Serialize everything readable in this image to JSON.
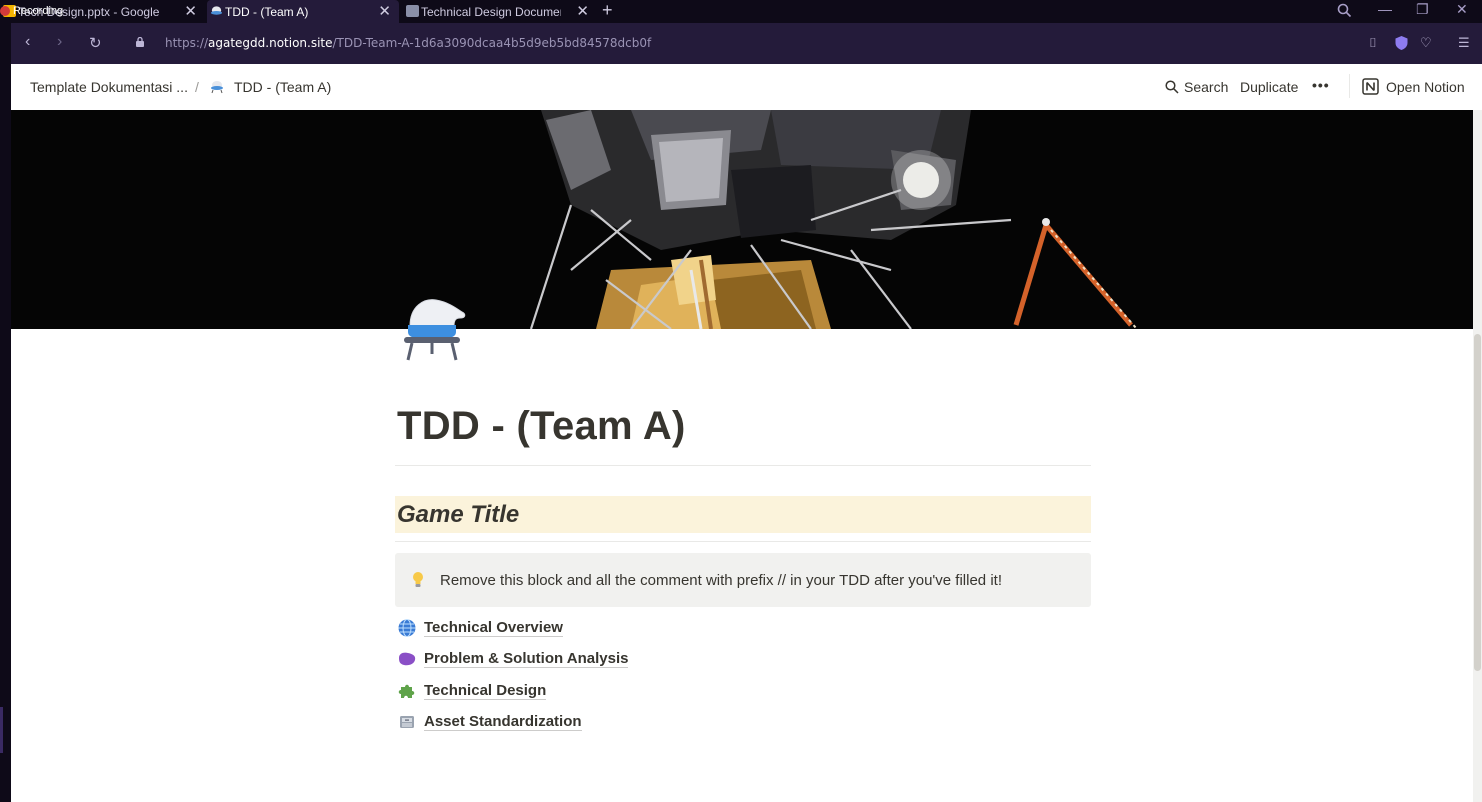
{
  "browser": {
    "recording_label": "Recording",
    "tabs": [
      {
        "title": "Tech Design.pptx - Google",
        "active": false
      },
      {
        "title": "TDD - (Team A)",
        "active": true
      },
      {
        "title": "Technical Design Documen",
        "active": false
      }
    ],
    "url_prefix": "https://",
    "url_host": "agategdd.notion.site",
    "url_path": "/TDD-Team-A-1d6a3090dcaa4b5d9eb5bd84578dcb0f"
  },
  "topbar": {
    "breadcrumb_parent": "Template Dokumentasi ...",
    "breadcrumb_separator": "/",
    "breadcrumb_current": "TDD - (Team A)",
    "search_label": "Search",
    "duplicate_label": "Duplicate",
    "more_label": "•••",
    "open_notion_label": "Open Notion"
  },
  "page": {
    "icon": "ufo-icon",
    "title": "TDD - (Team A)",
    "heading": "Game Title",
    "heading_bg": "#fbf3db",
    "callout_icon": "lightbulb-icon",
    "callout_text": "Remove this block and all the comment with prefix // in your TDD after you've filled it!",
    "links": [
      {
        "icon": "globe-icon",
        "label": "Technical Overview"
      },
      {
        "icon": "purple-blob-icon",
        "label": "Problem & Solution Analysis"
      },
      {
        "icon": "puzzle-piece-icon",
        "label": "Technical Design"
      },
      {
        "icon": "file-cabinet-icon",
        "label": "Asset Standardization"
      }
    ]
  }
}
